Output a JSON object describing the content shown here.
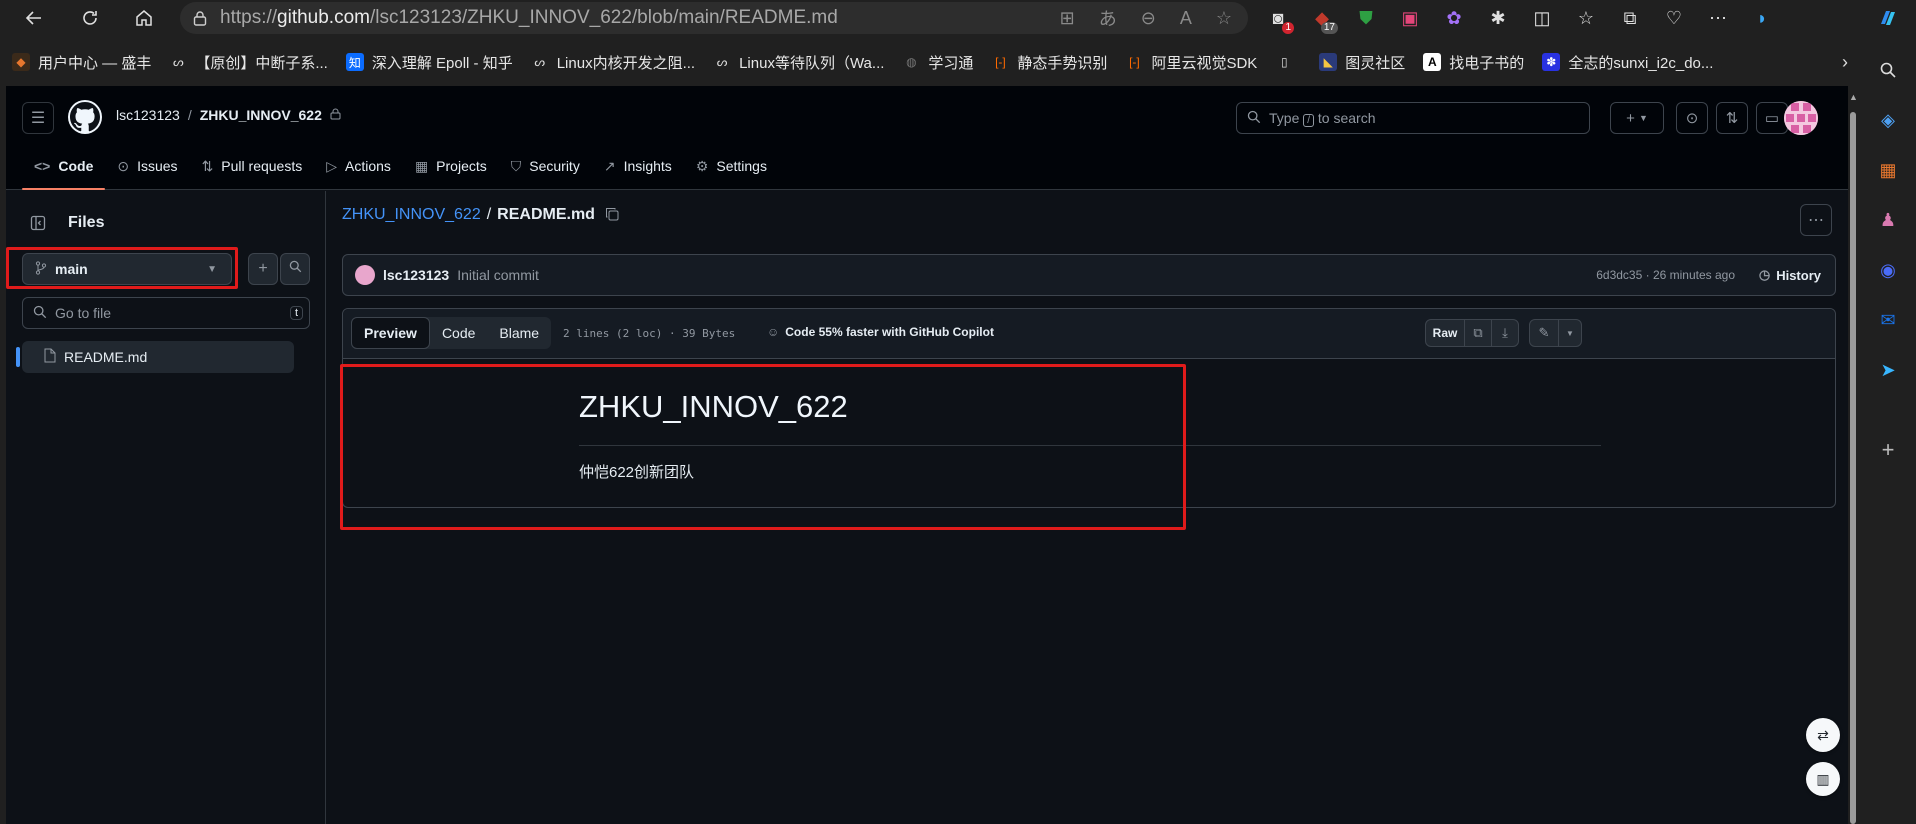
{
  "browser": {
    "url_prefix": "https://",
    "url_host": "github.com",
    "url_path": "/lsc123123/ZHKU_INNOV_622/blob/main/README.md",
    "ext_badges": {
      "ext1": "1",
      "ext2": "17"
    }
  },
  "bookmarks": [
    {
      "label": "用户中心 — 盛丰"
    },
    {
      "label": "【原创】中断子系..."
    },
    {
      "label": "深入理解 Epoll - 知乎",
      "icon_text": "知"
    },
    {
      "label": "Linux内核开发之阻..."
    },
    {
      "label": "Linux等待队列（Wa..."
    },
    {
      "label": "学习通"
    },
    {
      "label": "静态手势识别"
    },
    {
      "label": "阿里云视觉SDK"
    },
    {
      "label": ""
    },
    {
      "label": "图灵社区"
    },
    {
      "label": "找电子书的",
      "icon_text": "A"
    },
    {
      "label": "全志的sunxi_i2c_do..."
    }
  ],
  "github": {
    "owner": "lsc123123",
    "repo": "ZHKU_INNOV_622",
    "search_placeholder_pre": "Type",
    "search_kbd": "/",
    "search_placeholder_post": "to search",
    "tabs": [
      "Code",
      "Issues",
      "Pull requests",
      "Actions",
      "Projects",
      "Security",
      "Insights",
      "Settings"
    ]
  },
  "files_panel": {
    "title": "Files",
    "branch": "main",
    "goto_placeholder": "Go to file",
    "goto_kbd": "t",
    "tree": [
      "README.md"
    ]
  },
  "main": {
    "breadcrumb_repo": "ZHKU_INNOV_622",
    "breadcrumb_sep": "/",
    "breadcrumb_file": "README.md",
    "commit": {
      "author": "lsc123123",
      "message": "Initial commit",
      "meta": "6d3dc35 · 26 minutes ago",
      "history": "History"
    },
    "view_tabs": [
      "Preview",
      "Code",
      "Blame"
    ],
    "file_info": "2 lines (2 loc) · 39 Bytes",
    "copilot": "Code 55% faster with GitHub Copilot",
    "raw": "Raw",
    "readme_heading": "ZHKU_INNOV_622",
    "readme_text": "仲恺622创新团队"
  },
  "colors": {
    "accent_link": "#4493f8",
    "active_tab_underline": "#f78166",
    "highlight_box": "#e01b1b",
    "page_bg": "#0d1117"
  }
}
